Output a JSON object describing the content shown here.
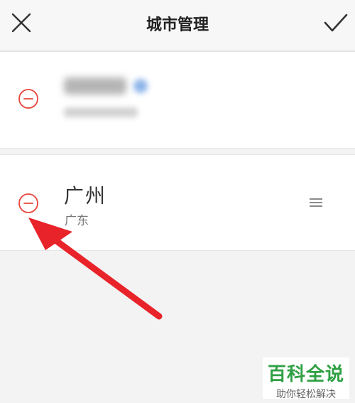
{
  "header": {
    "title": "城市管理",
    "close_icon": "close-icon",
    "confirm_icon": "checkmark-icon"
  },
  "cities": [
    {
      "name_blurred": true,
      "remove_icon": "minus-circle-icon"
    },
    {
      "name": "广州",
      "province": "广东",
      "remove_icon": "minus-circle-icon",
      "reorder_icon": "drag-handle-icon"
    }
  ],
  "annotation": {
    "arrow_color": "#e8232a"
  },
  "colors": {
    "remove_icon": "#e8473c",
    "accent": "#2ea043"
  },
  "watermark": {
    "main": "百科全说",
    "sub": "助你轻松解决"
  }
}
